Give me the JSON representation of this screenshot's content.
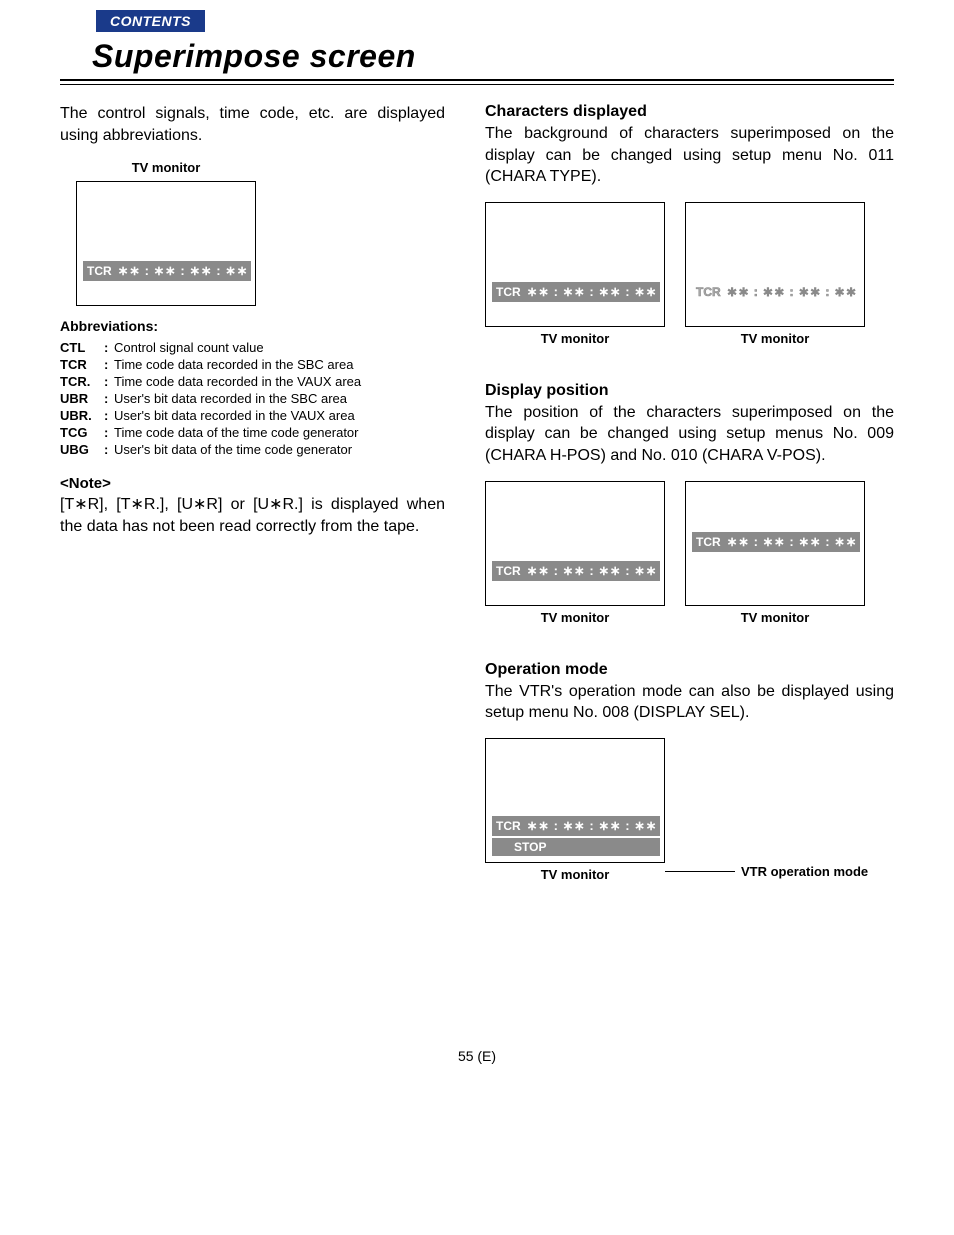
{
  "nav": {
    "contents": "CONTENTS"
  },
  "title": "Superimpose screen",
  "left": {
    "intro": "The control signals, time code, etc. are displayed using abbreviations.",
    "monitor_label": "TV monitor",
    "tcr_label": "TCR",
    "tcr_value": "∗∗ : ∗∗ : ∗∗ : ∗∗",
    "abbrev_head": "Abbreviations:",
    "abbrev": [
      {
        "key": "CTL",
        "desc": "Control signal count value"
      },
      {
        "key": "TCR",
        "desc": "Time code data recorded in the SBC area"
      },
      {
        "key": "TCR.",
        "desc": "Time code data recorded in the VAUX area"
      },
      {
        "key": "UBR",
        "desc": "User's bit data recorded in the SBC area"
      },
      {
        "key": "UBR.",
        "desc": "User's bit data recorded in the VAUX area"
      },
      {
        "key": "TCG",
        "desc": "Time code data of the time code generator"
      },
      {
        "key": "UBG",
        "desc": "User's bit data of the time code generator"
      }
    ],
    "note_head": "<Note>",
    "note_body": "[T∗R], [T∗R.], [U∗R] or [U∗R.] is displayed when the data has not been read correctly from the tape."
  },
  "right": {
    "chars": {
      "head": "Characters displayed",
      "body": "The background of characters superimposed on the display can be changed using setup menu No. 011 (CHARA TYPE).",
      "mon1_label": "TV monitor",
      "mon2_label": "TV monitor",
      "tcr_label": "TCR",
      "tcr_value": "∗∗ : ∗∗ : ∗∗ : ∗∗"
    },
    "pos": {
      "head": "Display position",
      "body": "The position of the characters superimposed on the display can be changed using setup menus No. 009 (CHARA H-POS) and No. 010 (CHARA V-POS).",
      "mon1_label": "TV monitor",
      "mon2_label": "TV monitor",
      "tcr_label": "TCR",
      "tcr_value": "∗∗ : ∗∗ : ∗∗ : ∗∗"
    },
    "op": {
      "head": "Operation mode",
      "body": "The VTR's operation mode can also be displayed using setup menu No. 008 (DISPLAY SEL).",
      "mon_label": "TV monitor",
      "tcr_label": "TCR",
      "tcr_value": "∗∗ : ∗∗ : ∗∗ : ∗∗",
      "stop": "STOP",
      "callout": "VTR operation mode"
    }
  },
  "page_num": "55 (E)"
}
